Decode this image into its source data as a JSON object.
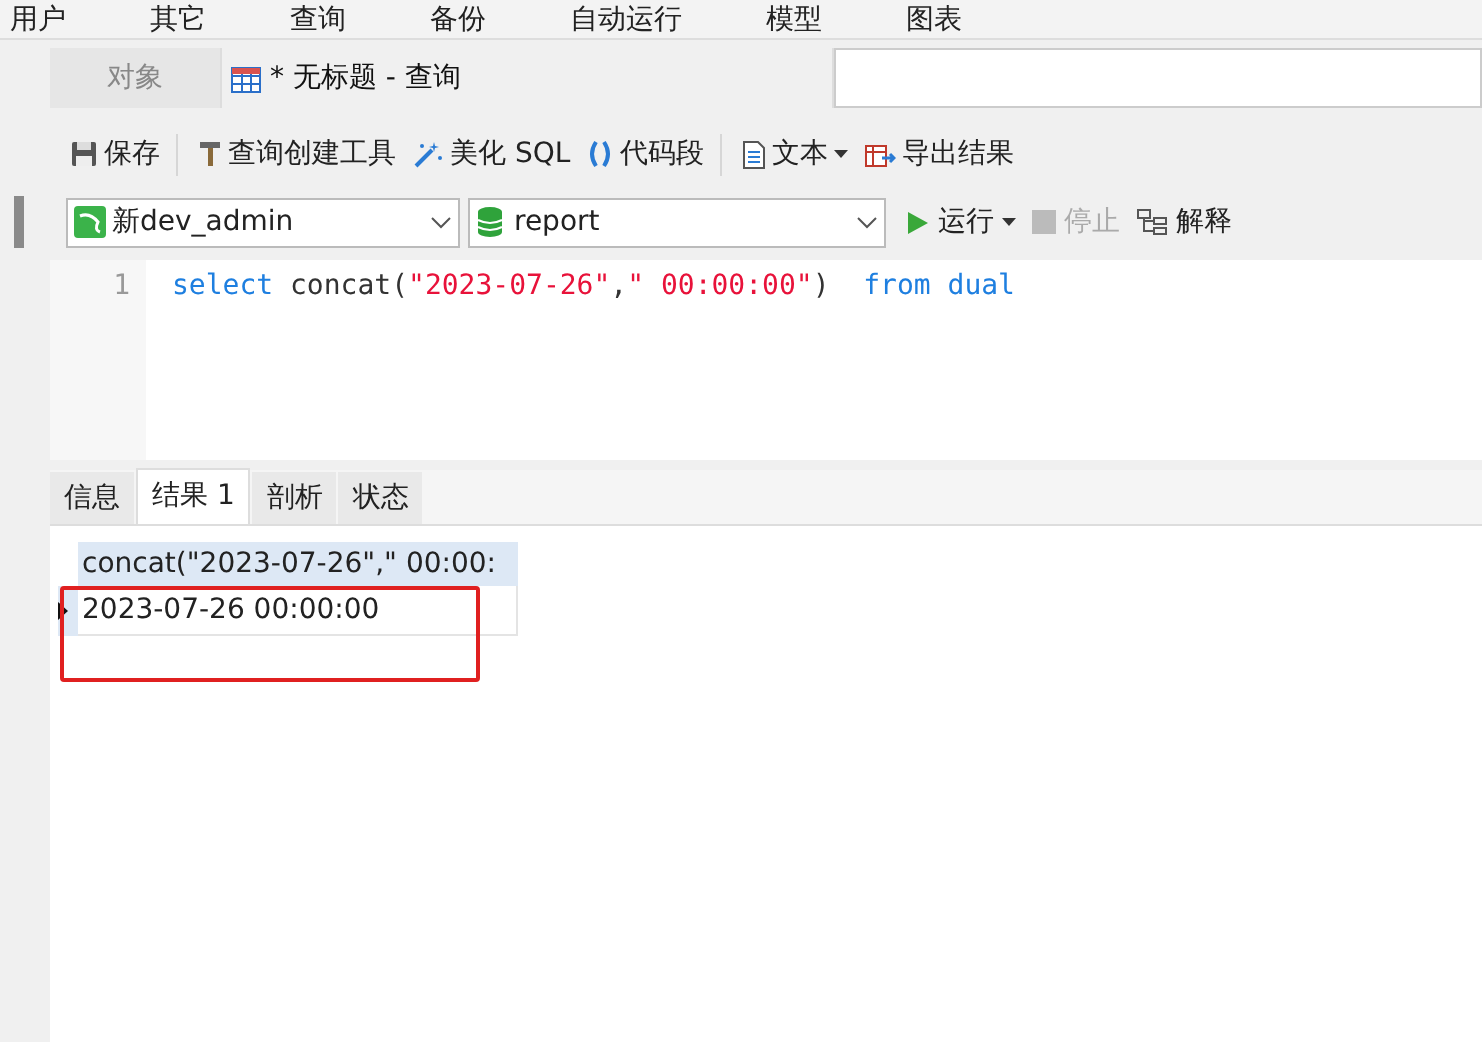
{
  "menu": [
    "用户",
    "其它",
    "查询",
    "备份",
    "自动运行",
    "模型",
    "图表"
  ],
  "tabs": [
    {
      "label": "对象",
      "selected": false,
      "kind": "plain"
    },
    {
      "label": "* 无标题 - 查询",
      "selected": true,
      "kind": "query"
    }
  ],
  "toolbar": [
    [
      {
        "label": "保存",
        "kind": "save"
      }
    ],
    [
      {
        "label": "查询创建工具",
        "kind": "builder"
      },
      {
        "label": "美化 SQL",
        "kind": "beautify"
      },
      {
        "label": "代码段",
        "kind": "snippet"
      }
    ],
    [
      {
        "label": "文本",
        "kind": "text",
        "dropdown": true
      },
      {
        "label": "导出结果",
        "kind": "export"
      }
    ]
  ],
  "connection": {
    "value": "新dev_admin"
  },
  "database": {
    "value": "report"
  },
  "run_buttons": [
    {
      "label": "运行",
      "kind": "run",
      "dropdown": true,
      "disabled": false
    },
    {
      "label": "停止",
      "kind": "stop",
      "disabled": true
    },
    {
      "label": "解释",
      "kind": "explain",
      "disabled": false
    }
  ],
  "editor": {
    "lines": [
      {
        "number": "1",
        "tokens": [
          {
            "text": "select",
            "kind": "keyword"
          },
          {
            "text": " concat(",
            "kind": "plain"
          },
          {
            "text": "\"2023-07-26\"",
            "kind": "string"
          },
          {
            "text": ",",
            "kind": "plain"
          },
          {
            "text": "\" 00:00:00\"",
            "kind": "string"
          },
          {
            "text": ")  ",
            "kind": "plain"
          },
          {
            "text": "from dual",
            "kind": "keyword"
          }
        ]
      }
    ]
  },
  "result_tabs": [
    {
      "label": "信息",
      "selected": false
    },
    {
      "label": "结果 1",
      "selected": true
    },
    {
      "label": "剖析",
      "selected": false
    },
    {
      "label": "状态",
      "selected": false
    }
  ],
  "grid": {
    "columns": [
      "concat(\"2023-07-26\",\" 00:00:"
    ],
    "rows": [
      {
        "current": true,
        "cells": [
          "2023-07-26 00:00:00"
        ]
      }
    ]
  }
}
